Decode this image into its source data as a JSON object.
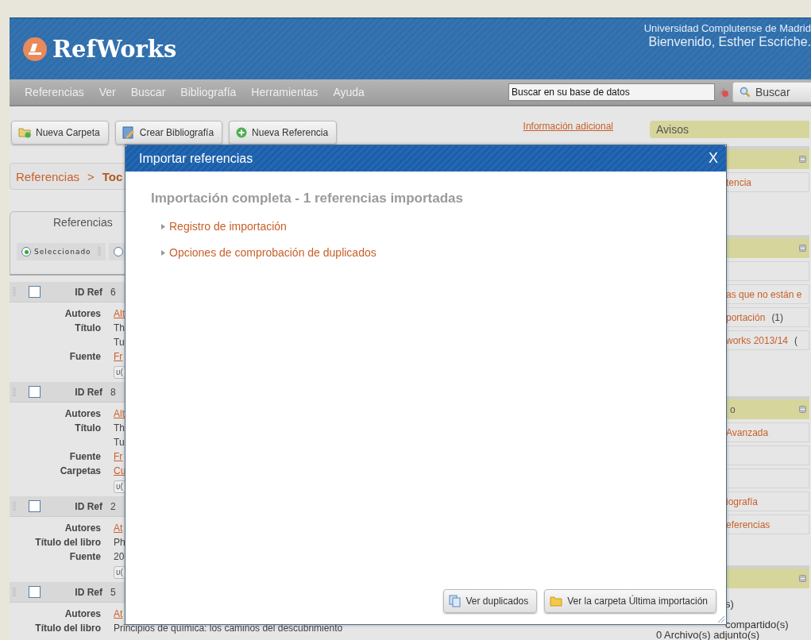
{
  "header": {
    "logo": "RefWorks",
    "institution": "Universidad Complutense de Madrid",
    "welcome": "Bienvenido, Esther Escriche."
  },
  "menu": [
    "Referencias",
    "Ver",
    "Buscar",
    "Bibliografía",
    "Herramientas",
    "Ayuda"
  ],
  "search": {
    "value": "Buscar en su base de datos",
    "button": "Buscar"
  },
  "toolbar": [
    {
      "label": "Nueva Carpeta",
      "kind": "folder"
    },
    {
      "label": "Crear Bibliografía",
      "kind": "document"
    },
    {
      "label": "Nueva Referencia",
      "kind": "add"
    }
  ],
  "info_link": "Información adicional",
  "breadcrumb": {
    "root": "Referencias",
    "separator": ">",
    "current": "Toc"
  },
  "tab": "Referencias",
  "radios": [
    {
      "label": "Seleccionado",
      "selected": true
    },
    {
      "selected": false
    }
  ],
  "references": [
    {
      "id_label": "ID Ref",
      "id": "6",
      "checked": false,
      "tag": "υ(",
      "fields": [
        {
          "label": "Autores",
          "kind": "link",
          "lines": [
            "Alt"
          ]
        },
        {
          "label": "Título",
          "kind": "text",
          "lines": [
            "Th",
            "Tu"
          ]
        },
        {
          "label": "Fuente",
          "kind": "link",
          "lines": [
            "Fr"
          ]
        }
      ]
    },
    {
      "id_label": "ID Ref",
      "id": "8",
      "checked": false,
      "tag": "υ(",
      "fields": [
        {
          "label": "Autores",
          "kind": "link",
          "lines": [
            "Alt"
          ]
        },
        {
          "label": "Título",
          "kind": "text",
          "lines": [
            "Th",
            "Tu"
          ]
        },
        {
          "label": "Fuente",
          "kind": "link",
          "lines": [
            "Fr"
          ]
        },
        {
          "label": "Carpetas",
          "kind": "link",
          "lines": [
            "Cu"
          ]
        }
      ]
    },
    {
      "id_label": "ID Ref",
      "id": "2",
      "checked": false,
      "tag": "υ(",
      "fields": [
        {
          "label": "Autores",
          "kind": "link",
          "lines": [
            "At"
          ]
        },
        {
          "label": "Título del libro",
          "kind": "text",
          "lines": [
            "Ph"
          ]
        },
        {
          "label": "Fuente",
          "kind": "text",
          "lines": [
            "20"
          ]
        }
      ]
    },
    {
      "id_label": "ID Ref",
      "id": "5",
      "checked": false,
      "fields": [
        {
          "label": "Autores",
          "kind": "link",
          "lines": [
            "At"
          ]
        },
        {
          "label": "Título del libro",
          "kind": "text",
          "lines": [
            "Principios de química: los caminos del descubrimiento"
          ]
        }
      ]
    }
  ],
  "sidebar": {
    "notices": "Avisos",
    "panels": [
      {
        "items": [
          {
            "kind": "link",
            "text": "tencia"
          }
        ]
      },
      {
        "items": [
          {
            "kind": "box"
          },
          {
            "kind": "link",
            "text": "as que no están e"
          },
          {
            "kind": "link",
            "text": "portación",
            "count": "(1)"
          },
          {
            "kind": "link",
            "text": "works 2013/14",
            "count": "("
          }
        ]
      },
      {
        "title": "o",
        "items": [
          {
            "kind": "link",
            "text": "Avanzada"
          },
          {
            "kind": "box"
          },
          {
            "kind": "box"
          },
          {
            "kind": "link",
            "text": "iografía"
          },
          {
            "kind": "link",
            "text": "eferencias"
          }
        ]
      },
      {
        "items": [
          {
            "kind": "text",
            "text": "s)"
          },
          {
            "kind": "text",
            "text": "compartido(s)"
          },
          {
            "kind": "note",
            "text": "0 Archivo(s) adjunto(s)"
          }
        ]
      }
    ]
  },
  "dialog": {
    "title": "Importar referencias",
    "close": "X",
    "heading": "Importación completa - 1 referencias importadas",
    "sections": [
      {
        "label": "Registro de importación",
        "expanded": false
      },
      {
        "label": "Opciones de comprobación de duplicados",
        "expanded": false
      }
    ],
    "buttons": [
      {
        "label": "Ver duplicados",
        "kind": "copy"
      },
      {
        "label": "Ver la carpeta Última importación",
        "kind": "folder"
      }
    ]
  }
}
